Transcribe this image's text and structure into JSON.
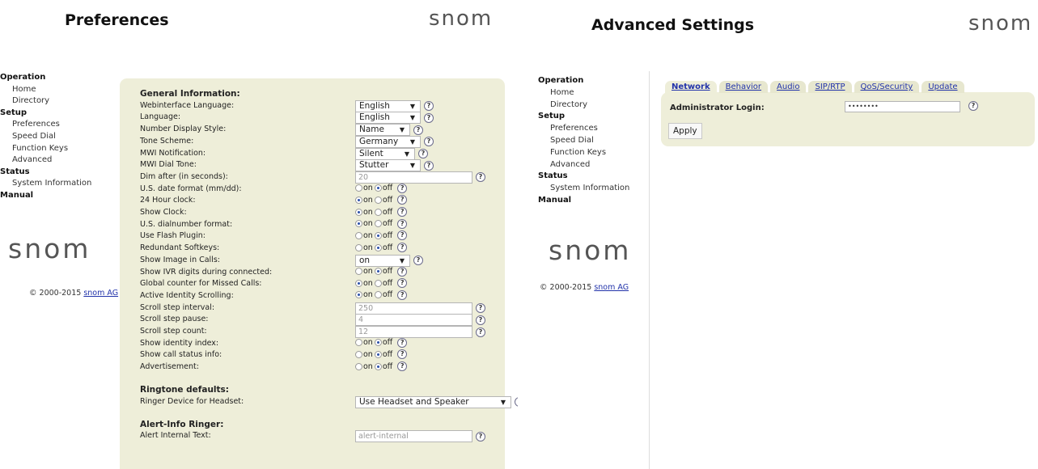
{
  "left": {
    "title": "Preferences",
    "brand": "snom",
    "nav": {
      "operation": "Operation",
      "home": "Home",
      "directory": "Directory",
      "setup": "Setup",
      "preferences": "Preferences",
      "speed_dial": "Speed Dial",
      "function_keys": "Function Keys",
      "advanced": "Advanced",
      "status": "Status",
      "system_information": "System Information",
      "manual": "Manual"
    },
    "logo": "snom",
    "copyright": "© 2000-2015 ",
    "copyright_link": "snom AG",
    "help_glyph": "?",
    "radio_on": "on",
    "radio_off": "off",
    "rows": [
      {
        "type": "header",
        "label": "General Information:"
      },
      {
        "type": "select",
        "label": "Webinterface Language:",
        "value": "English"
      },
      {
        "type": "select",
        "label": "Language:",
        "value": "English"
      },
      {
        "type": "select",
        "label": "Number Display Style:",
        "value": "Name"
      },
      {
        "type": "select",
        "label": "Tone Scheme:",
        "value": "Germany"
      },
      {
        "type": "select",
        "label": "MWI Notification:",
        "value": "Silent"
      },
      {
        "type": "select",
        "label": "MWI Dial Tone:",
        "value": "Stutter"
      },
      {
        "type": "text",
        "label": "Dim after (in seconds):",
        "value": "20"
      },
      {
        "type": "radio",
        "label": "U.S. date format (mm/dd):",
        "value": "off"
      },
      {
        "type": "radio",
        "label": "24 Hour clock:",
        "value": "on"
      },
      {
        "type": "radio",
        "label": "Show Clock:",
        "value": "on"
      },
      {
        "type": "radio",
        "label": "U.S. dialnumber format:",
        "value": "on"
      },
      {
        "type": "radio",
        "label": "Use Flash Plugin:",
        "value": "off"
      },
      {
        "type": "radio",
        "label": "Redundant Softkeys:",
        "value": "off"
      },
      {
        "type": "select",
        "label": "Show Image in Calls:",
        "value": "on"
      },
      {
        "type": "radio",
        "label": "Show IVR digits during connected:",
        "value": "off"
      },
      {
        "type": "radio",
        "label": "Global counter for Missed Calls:",
        "value": "on"
      },
      {
        "type": "radio",
        "label": "Active Identity Scrolling:",
        "value": "on"
      },
      {
        "type": "text",
        "label": "Scroll step interval:",
        "value": "250"
      },
      {
        "type": "text",
        "label": "Scroll step pause:",
        "value": "4"
      },
      {
        "type": "text",
        "label": "Scroll step count:",
        "value": "12"
      },
      {
        "type": "radio",
        "label": "Show identity index:",
        "value": "off"
      },
      {
        "type": "radio",
        "label": "Show call status info:",
        "value": "off"
      },
      {
        "type": "radio",
        "label": "Advertisement:",
        "value": "off"
      },
      {
        "type": "spacer"
      },
      {
        "type": "header",
        "label": "Ringtone defaults:"
      },
      {
        "type": "select",
        "label": "Ringer Device for Headset:",
        "value": "Use Headset and Speaker"
      },
      {
        "type": "spacer"
      },
      {
        "type": "header",
        "label": "Alert-Info Ringer:"
      },
      {
        "type": "text",
        "label": "Alert Internal Text:",
        "value": "alert-internal"
      }
    ]
  },
  "right": {
    "title": "Advanced Settings",
    "brand": "snom",
    "nav": {
      "operation": "Operation",
      "home": "Home",
      "directory": "Directory",
      "setup": "Setup",
      "preferences": "Preferences",
      "speed_dial": "Speed Dial",
      "function_keys": "Function Keys",
      "advanced": "Advanced",
      "status": "Status",
      "system_information": "System Information",
      "manual": "Manual"
    },
    "logo": "snom",
    "copyright": "© 2000-2015 ",
    "copyright_link": "snom AG",
    "tabs": [
      "Network",
      "Behavior",
      "Audio",
      "SIP/RTP",
      "QoS/Security",
      "Update"
    ],
    "admin_label": "Administrator Login:",
    "admin_value": "••••••••",
    "apply_label": "Apply",
    "help_glyph": "?"
  }
}
